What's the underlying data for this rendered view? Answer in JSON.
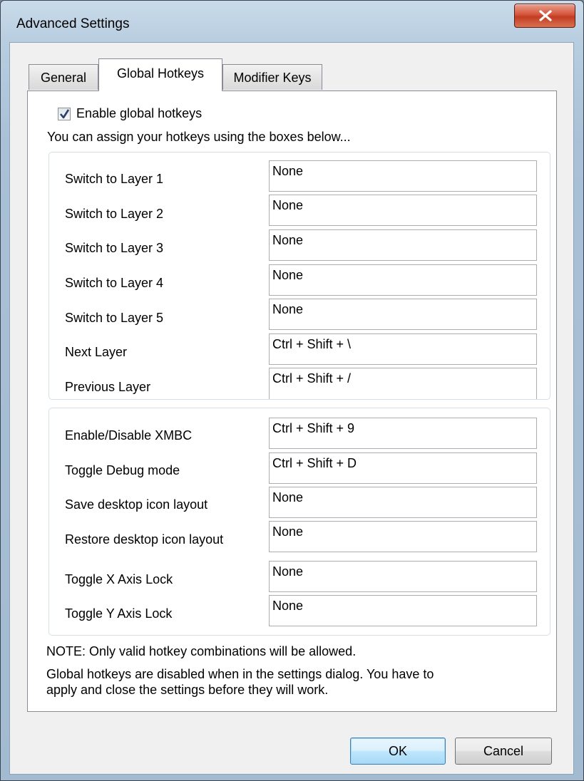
{
  "window": {
    "title": "Advanced Settings",
    "close_icon": "close-icon"
  },
  "tabs": [
    {
      "label": "General",
      "active": false
    },
    {
      "label": "Global Hotkeys",
      "active": true
    },
    {
      "label": "Modifier Keys",
      "active": false
    }
  ],
  "global_hotkeys": {
    "enable_checkbox": {
      "label": "Enable global hotkeys",
      "checked": true
    },
    "intro": "You can assign your hotkeys using the boxes below...",
    "layer_group": [
      {
        "label": "Switch to Layer 1",
        "value": "None"
      },
      {
        "label": "Switch to Layer 2",
        "value": "None"
      },
      {
        "label": "Switch to Layer 3",
        "value": "None"
      },
      {
        "label": "Switch to Layer 4",
        "value": "None"
      },
      {
        "label": "Switch to Layer 5",
        "value": "None"
      },
      {
        "label": "Next Layer",
        "value": "Ctrl + Shift + \\"
      },
      {
        "label": "Previous Layer",
        "value": "Ctrl + Shift + /"
      }
    ],
    "misc_group": [
      {
        "label": "Enable/Disable XMBC",
        "value": "Ctrl + Shift + 9"
      },
      {
        "label": "Toggle Debug mode",
        "value": "Ctrl + Shift + D"
      },
      {
        "label": "Save desktop icon layout",
        "value": "None"
      },
      {
        "label": "Restore desktop icon layout",
        "value": "None"
      },
      {
        "label": "Toggle X Axis Lock",
        "value": "None"
      },
      {
        "label": "Toggle Y Axis Lock",
        "value": "None"
      }
    ],
    "note": "NOTE: Only valid hotkey combinations will be allowed.",
    "info_line1": "Global hotkeys are disabled when in the settings dialog. You have to",
    "info_line2": "apply and close the settings before they will work."
  },
  "buttons": {
    "ok": "OK",
    "cancel": "Cancel"
  }
}
